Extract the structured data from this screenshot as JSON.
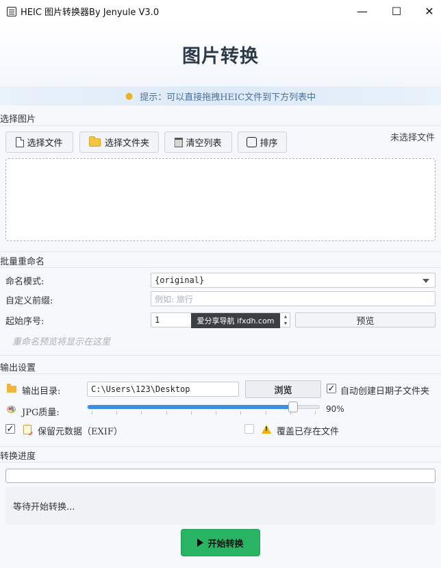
{
  "window": {
    "title": "HEIC 图片转换器By Jenyule V3.0",
    "minimize": "—",
    "maximize": "☐",
    "close": "✕"
  },
  "header": {
    "title": "图片转换"
  },
  "tip": {
    "icon": "lightbulb-icon",
    "text": "提示：可以直接拖拽HEIC文件到下方列表中"
  },
  "select_images": {
    "section_title": "选择图片",
    "buttons": {
      "select_files": "选择文件",
      "select_folder": "选择文件夹",
      "clear_list": "清空列表",
      "sort": "排序"
    },
    "status": "未选择文件"
  },
  "rename": {
    "section_title": "批量重命名",
    "mode_label": "命名模式:",
    "mode_value": "{original}",
    "prefix_label": "自定义前缀:",
    "prefix_placeholder": "例如: 旅行",
    "start_label": "起始序号:",
    "start_value": "1",
    "preview_button": "预览",
    "preview_hint": "重命名预览将显示在这里"
  },
  "watermark": "爱分享导航 ifxdh.com",
  "output": {
    "section_title": "输出设置",
    "dir_label": "输出目录:",
    "dir_value": "C:\\Users\\123\\Desktop",
    "browse_button": "浏览",
    "auto_date_label": "自动创建日期子文件夹",
    "auto_date_checked": true,
    "quality_label": "JPG质量:",
    "quality_value": 90,
    "quality_text": "90%",
    "exif_label": "保留元数据（EXIF）",
    "exif_checked": true,
    "overwrite_label": "覆盖已存在文件",
    "overwrite_checked": false
  },
  "progress": {
    "section_title": "转换进度",
    "percent": 0,
    "status": "等待开始转换..."
  },
  "start_button": "开始转换",
  "colors": {
    "accent": "#3e8ee0",
    "start": "#28b463",
    "tip_text": "#4a6f98"
  }
}
